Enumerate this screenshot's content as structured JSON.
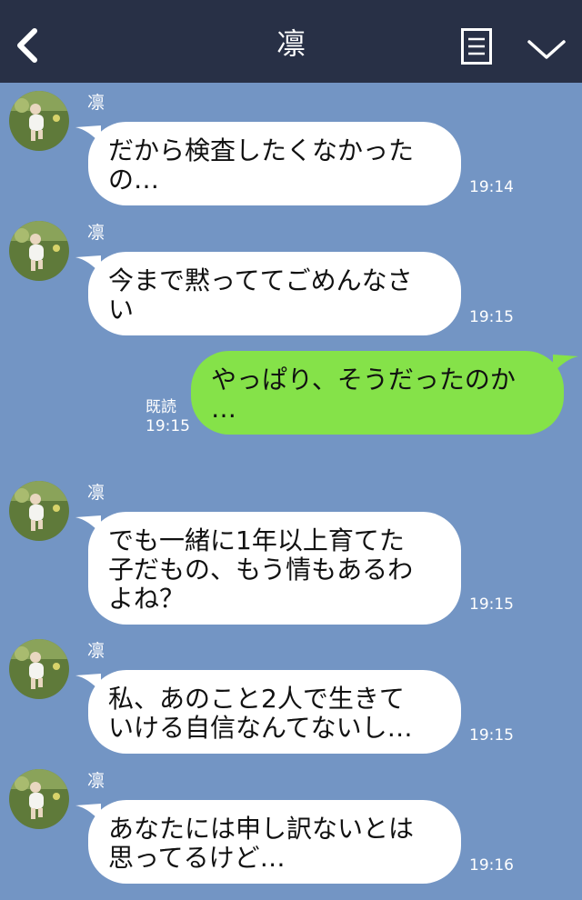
{
  "header": {
    "title": "凛"
  },
  "messages": [
    {
      "sender": "凛",
      "text": "だから検査したくなかった\nの…",
      "time": "19:14"
    },
    {
      "sender": "凛",
      "text": "今まで黙っててごめんなさ\nい",
      "time": "19:15"
    },
    {
      "text": "やっぱり、そうだったのか\n…",
      "read": "既読",
      "time": "19:15"
    },
    {
      "sender": "凛",
      "text": "でも一緒に1年以上育てた\n子だもの、もう情もあるわ\nよね？",
      "time": "19:15"
    },
    {
      "sender": "凛",
      "text": "私、あのこと2人で生きて\nいける自信なんてないし…",
      "time": "19:15"
    },
    {
      "sender": "凛",
      "text": "あなたには申し訳ないとは\n思ってるけど…",
      "time": "19:16"
    }
  ],
  "colors": {
    "header_bg": "#283046",
    "chat_bg": "#7395c4",
    "incoming_bubble": "#ffffff",
    "outgoing_bubble": "#85e249"
  },
  "icons": {
    "back": "chevron-left-icon",
    "menu": "note-list-icon",
    "dropdown": "chevron-down-icon"
  }
}
